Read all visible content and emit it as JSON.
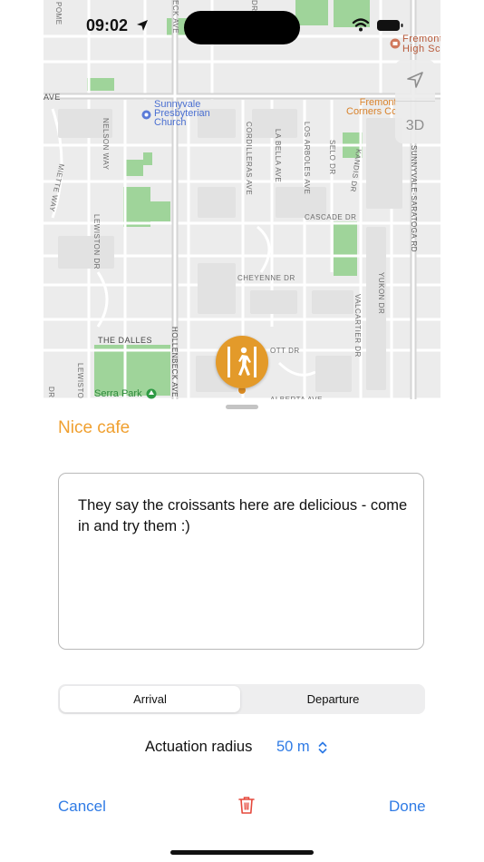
{
  "status_bar": {
    "time": "09:02"
  },
  "map": {
    "labels": {
      "ave_left": "AVE",
      "church": "Sunnyvale\nPresbyterian\nChurch",
      "fremont_high": "Fremont\nHigh Sc",
      "fremont_corners": "Fremont\nCorners Cc",
      "nelson_way": "NELSON WAY",
      "miette_way": "MIETTE WAY",
      "lewiston_dr": "LEWISTON DR",
      "lewiston_dr_2": "LEWISTON",
      "cordilleras_ave": "CORDILLERAS AVE",
      "la_bella_ave": "LA BELLA AVE",
      "los_arboles_ave": "LOS ARBOLES AVE",
      "selo_dr": "SELO DR",
      "kandis_dr": "KANDIS DR",
      "sunnyvale_saratoga_rd": "SUNNYVALE-SARATOGA RD",
      "cascade_dr": "CASCADE DR",
      "cheyenne_dr": "CHEYENNE DR",
      "yukon_dr": "YUKON DR",
      "valcartier_dr": "VALCARTIER DR",
      "the_dalles": "THE DALLES",
      "hollenbeck_ave": "HOLLENBECK AVE",
      "eck_ave": "ECK AVE",
      "ott_dr": "OTT DR",
      "alberta_ave": "ALBERTA AVE",
      "serra_park": "Serra Park",
      "pome": "POME",
      "dr_top": "DR",
      "dr_left": "DR"
    },
    "controls": {
      "three_d": "3D"
    },
    "pin_icon": "walking-person-icon"
  },
  "sheet": {
    "title": "Nice cafe",
    "note": "They say the croissants here are delicious - come in and try them :)",
    "segment": {
      "options": [
        "Arrival",
        "Departure"
      ],
      "selected": "Arrival"
    },
    "radius_label": "Actuation radius",
    "radius_value": "50 m",
    "cancel_label": "Cancel",
    "done_label": "Done",
    "delete_icon": "trash-icon"
  },
  "colors": {
    "accent_orange": "#f0a030",
    "link_blue": "#2f7be5",
    "delete_red": "#e5483c",
    "pin_orange": "#e39a2a"
  }
}
